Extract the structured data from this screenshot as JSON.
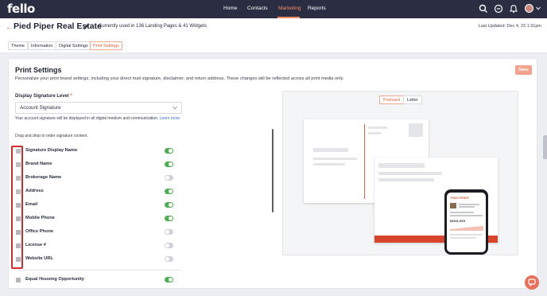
{
  "app": {
    "logo_text": "fello"
  },
  "nav": {
    "links": [
      "Home",
      "Contacts",
      "Marketing",
      "Reports"
    ],
    "active": "Marketing",
    "icons": [
      "search-icon",
      "tag-icon",
      "bell-icon",
      "avatar"
    ]
  },
  "header": {
    "title": "Pied Piper Real Estate",
    "usage": "Currently used in 136 Landing Pages & 41 Widgets",
    "last_updated": "Last Updated: Dec 4, 23 1:31pm"
  },
  "tabs": [
    {
      "label": "Theme",
      "active": false
    },
    {
      "label": "Information",
      "active": false
    },
    {
      "label": "Digital Settings",
      "active": false
    },
    {
      "label": "Print Settings",
      "active": true
    }
  ],
  "settings": {
    "title": "Print Settings",
    "description": "Personalize your print brand settings, including your direct mail signature, disclaimer, and return address. These changes will be reflected across all print media only.",
    "save_label": "Save",
    "field_label": "Display Signature Level",
    "required_mark": "*",
    "select_value": "Account Signature",
    "helper_text": "Your account signature will be displayed in all digital medium and communication.",
    "helper_link": "Learn more",
    "drag_hint": "Drag and drop to order signature content.",
    "items": [
      {
        "label": "Signature Display Name",
        "on": true
      },
      {
        "label": "Brand Name",
        "on": true
      },
      {
        "label": "Brokerage Name",
        "on": false
      },
      {
        "label": "Address",
        "on": true
      },
      {
        "label": "Email",
        "on": true
      },
      {
        "label": "Mobile Phone",
        "on": true
      },
      {
        "label": "Office Phone",
        "on": false
      },
      {
        "label": "License #",
        "on": false
      },
      {
        "label": "Website URL",
        "on": false
      },
      {
        "label": "Equal Housing Opportunity",
        "on": true
      }
    ]
  },
  "preview": {
    "segments": [
      "Postcard",
      "Letter"
    ],
    "active_segment": "Postcard",
    "phone_brand": "PIED PIPER",
    "phone_price": "$XXX,XXX"
  },
  "colors": {
    "accent": "#e4603f",
    "toggle_on": "#4caf50",
    "highlight": "#d62b2b",
    "nav_bg": "#2b2d42"
  }
}
